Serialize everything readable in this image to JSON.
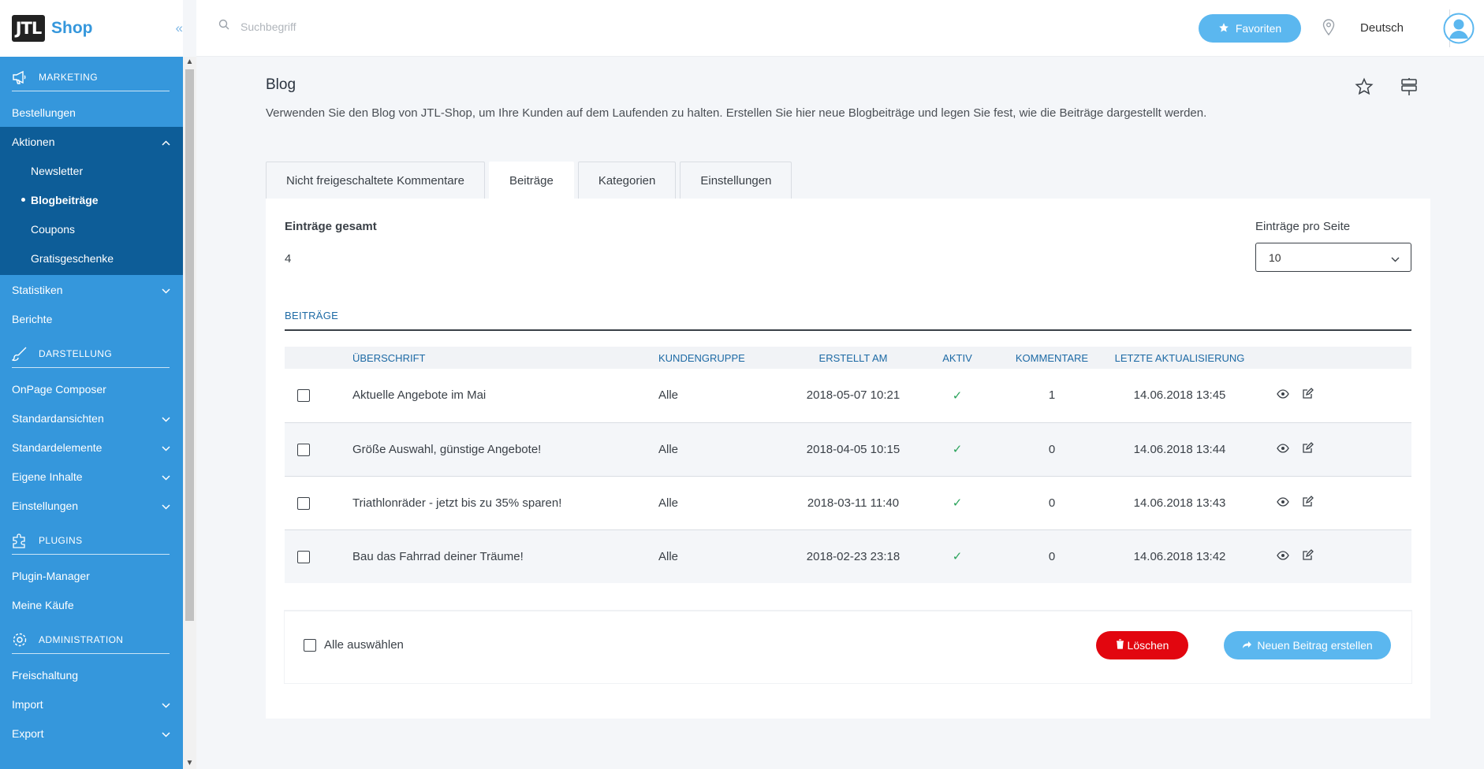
{
  "brand": {
    "logo_text": "JTL",
    "name": "Shop",
    "collapse_glyph": "«"
  },
  "search": {
    "placeholder": "Suchbegriff"
  },
  "header": {
    "favorites_label": "Favoriten",
    "language": "Deutsch"
  },
  "sidebar": {
    "marketing_section": "MARKETING",
    "bestellungen": "Bestellungen",
    "aktionen": "Aktionen",
    "aktionen_sub": [
      "Newsletter",
      "Blogbeiträge",
      "Coupons",
      "Gratisgeschenke"
    ],
    "statistiken": "Statistiken",
    "berichte": "Berichte",
    "darstellung_section": "DARSTELLUNG",
    "onpage": "OnPage Composer",
    "standardansichten": "Standardansichten",
    "standardelemente": "Standardelemente",
    "eigene_inhalte": "Eigene Inhalte",
    "einstellungen": "Einstellungen",
    "plugins_section": "PLUGINS",
    "plugin_manager": "Plugin-Manager",
    "meine_kaeufe": "Meine Käufe",
    "administration_section": "ADMINISTRATION",
    "freischaltung": "Freischaltung",
    "import": "Import",
    "export": "Export"
  },
  "page": {
    "title": "Blog",
    "description": "Verwenden Sie den Blog von JTL-Shop, um Ihre Kunden auf dem Laufenden zu halten. Erstellen Sie hier neue Blogbeiträge und legen Sie fest, wie die Beiträge dargestellt werden."
  },
  "tabs": [
    "Nicht freigeschaltete Kommentare",
    "Beiträge",
    "Kategorien",
    "Einstellungen"
  ],
  "stats": {
    "total_label": "Einträge gesamt",
    "total_value": "4",
    "per_page_label": "Einträge pro Seite",
    "per_page_value": "10"
  },
  "section_heading": "BEITRÄGE",
  "table": {
    "headers": [
      "ÜBERSCHRIFT",
      "KUNDENGRUPPE",
      "ERSTELLT AM",
      "AKTIV",
      "KOMMENTARE",
      "LETZTE AKTUALISIERUNG"
    ],
    "rows": [
      {
        "title": "Aktuelle Angebote im Mai",
        "group": "Alle",
        "created": "2018-05-07 10:21",
        "active": "✓",
        "comments": "1",
        "updated": "14.06.2018 13:45"
      },
      {
        "title": "Größe Auswahl, günstige Angebote!",
        "group": "Alle",
        "created": "2018-04-05 10:15",
        "active": "✓",
        "comments": "0",
        "updated": "14.06.2018 13:44"
      },
      {
        "title": "Triathlonräder - jetzt bis zu 35% sparen!",
        "group": "Alle",
        "created": "2018-03-11 11:40",
        "active": "✓",
        "comments": "0",
        "updated": "14.06.2018 13:43"
      },
      {
        "title": "Bau das Fahrrad deiner Träume!",
        "group": "Alle",
        "created": "2018-02-23 23:18",
        "active": "✓",
        "comments": "0",
        "updated": "14.06.2018 13:42"
      }
    ]
  },
  "footer": {
    "select_all": "Alle auswählen",
    "delete_label": "Löschen",
    "new_label": "Neuen Beitrag erstellen"
  },
  "colors": {
    "sidebar": "#3597dc",
    "sidebar_active": "#0d5d98",
    "accent": "#5bb7ef",
    "danger": "#e2060f",
    "header_text": "#1d6aa5",
    "check": "#2aa35b"
  }
}
